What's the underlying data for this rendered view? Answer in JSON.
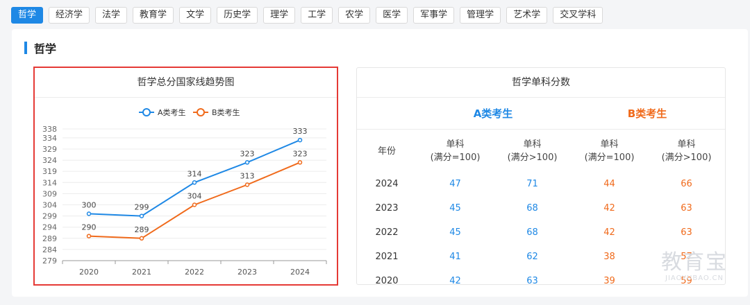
{
  "tabs": [
    {
      "label": "哲学",
      "active": true
    },
    {
      "label": "经济学"
    },
    {
      "label": "法学"
    },
    {
      "label": "教育学"
    },
    {
      "label": "文学"
    },
    {
      "label": "历史学"
    },
    {
      "label": "理学"
    },
    {
      "label": "工学"
    },
    {
      "label": "农学"
    },
    {
      "label": "医学"
    },
    {
      "label": "军事学"
    },
    {
      "label": "管理学"
    },
    {
      "label": "艺术学"
    },
    {
      "label": "交叉学科"
    }
  ],
  "section": {
    "title": "哲学"
  },
  "chart_box": {
    "title": "哲学总分国家线趋势图"
  },
  "chart_data": {
    "type": "line",
    "title": "哲学总分国家线趋势图",
    "x": [
      "2020",
      "2021",
      "2022",
      "2023",
      "2024"
    ],
    "y_ticks": [
      279,
      284,
      289,
      294,
      299,
      304,
      309,
      314,
      319,
      324,
      329,
      334,
      338
    ],
    "ylim": [
      279,
      338
    ],
    "grid": true,
    "legend_position": "top-center",
    "series": [
      {
        "name": "A类考生",
        "color": "#1e88e5",
        "values": [
          300,
          299,
          314,
          323,
          333
        ]
      },
      {
        "name": "B类考生",
        "color": "#f06a1b",
        "values": [
          290,
          289,
          304,
          313,
          323
        ]
      }
    ]
  },
  "score_table": {
    "title": "哲学单科分数",
    "group_a": "A类考生",
    "group_b": "B类考生",
    "headers": {
      "year": "年份",
      "c1": {
        "line1": "单科",
        "line2": "(满分=100)"
      },
      "c2": {
        "line1": "单科",
        "line2": "(满分>100)"
      },
      "c3": {
        "line1": "单科",
        "line2": "(满分=100)"
      },
      "c4": {
        "line1": "单科",
        "line2": "(满分>100)"
      }
    },
    "rows": [
      {
        "year": "2024",
        "a1": "47",
        "a2": "71",
        "b1": "44",
        "b2": "66"
      },
      {
        "year": "2023",
        "a1": "45",
        "a2": "68",
        "b1": "42",
        "b2": "63"
      },
      {
        "year": "2022",
        "a1": "45",
        "a2": "68",
        "b1": "42",
        "b2": "63"
      },
      {
        "year": "2021",
        "a1": "41",
        "a2": "62",
        "b1": "38",
        "b2": "57"
      },
      {
        "year": "2020",
        "a1": "42",
        "a2": "63",
        "b1": "39",
        "b2": "59"
      }
    ]
  },
  "watermark": {
    "big": "教育宝",
    "small": "JIAOYUBAO.CN"
  }
}
